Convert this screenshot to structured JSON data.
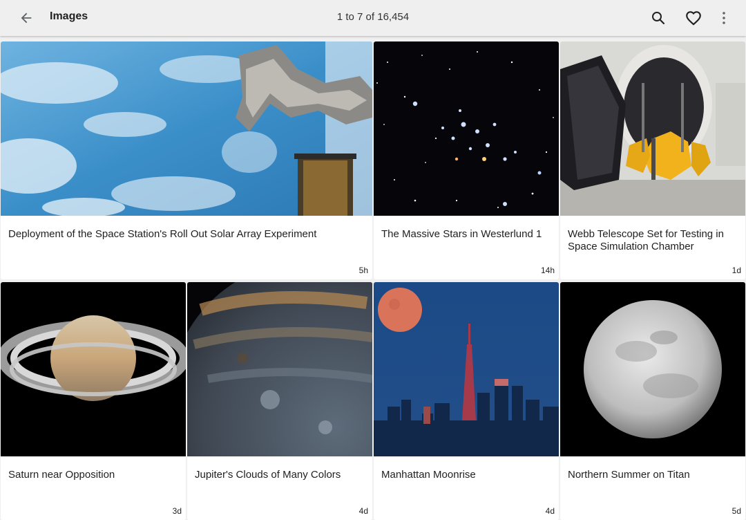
{
  "appbar": {
    "title": "Images",
    "counter": "1 to 7 of 16,454",
    "icons": [
      "back-arrow-icon",
      "search-icon",
      "heart-icon",
      "more-vert-icon"
    ]
  },
  "cards": [
    {
      "title": "Deployment of the Space Station's Roll Out Solar Array Experiment",
      "age": "5h"
    },
    {
      "title": "The Massive Stars in Westerlund 1",
      "age": "14h"
    },
    {
      "title": "Webb Telescope Set for Testing in Space Simulation Chamber",
      "age": "1d"
    },
    {
      "title": "Saturn near Opposition",
      "age": "3d"
    },
    {
      "title": "Jupiter's Clouds of Many Colors",
      "age": "4d"
    },
    {
      "title": "Manhattan Moonrise",
      "age": "4d"
    },
    {
      "title": "Northern Summer on Titan",
      "age": "5d"
    }
  ],
  "colors": {
    "appbar": "#efefef",
    "background": "#f0f0f0",
    "card": "#ffffff",
    "text": "#212121"
  }
}
